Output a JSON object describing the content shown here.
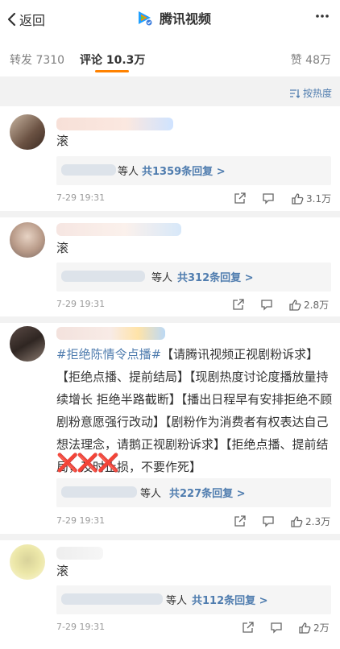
{
  "nav": {
    "back_label": "返回",
    "title": "腾讯视频"
  },
  "tabs": {
    "repost": "转发 7310",
    "comment": "评论 10.3万",
    "like": "赞 48万"
  },
  "sort_label": "按热度",
  "comments": [
    {
      "text": "滚",
      "reply_who": "等人",
      "reply_count": "共1359条回复 >",
      "time": "7-29 19:31",
      "likes": "3.1万"
    },
    {
      "text": "滚",
      "reply_who": "等人",
      "reply_count": "共312条回复 >",
      "time": "7-29 19:31",
      "likes": "2.8万"
    },
    {
      "topic": "#拒绝陈情令点播#",
      "text": "【请腾讯视频正视剧粉诉求】【拒绝点播、提前结局】【现剧热度讨论度播放量持续增长 拒绝半路截断】【播出日程早有安排拒绝不顾剧粉意愿强行改动】【剧粉作为消费者有权表达自己想法理念，请鹅正视剧粉诉求】【拒绝点播、提前结局，及时止损，不要作死】",
      "marks": "❌❌❌",
      "reply_who": "等人",
      "reply_count": "共227条回复 >",
      "time": "7-29 19:31",
      "likes": "2.3万"
    },
    {
      "text": "滚",
      "reply_who": "等人",
      "reply_count": "共112条回复 >",
      "time": "7-29 19:31",
      "likes": "2万"
    }
  ]
}
